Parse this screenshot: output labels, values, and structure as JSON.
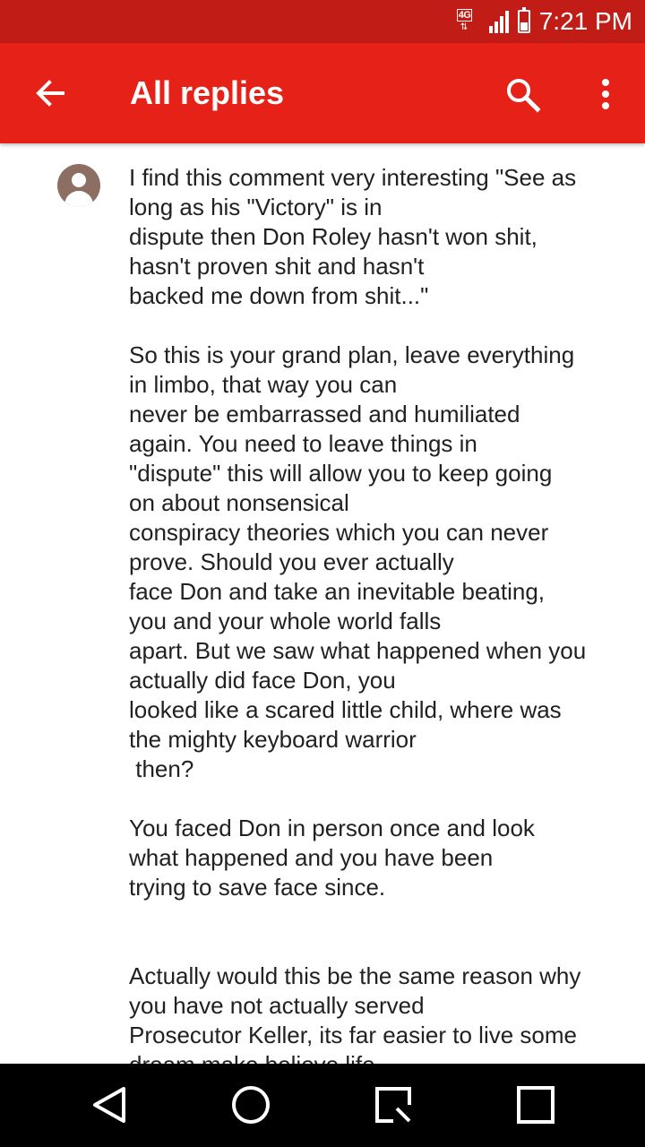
{
  "status_bar": {
    "network_badge": "4G",
    "time": "7:21 PM",
    "battery_level": 0.4,
    "signal_bars": 4
  },
  "app_bar": {
    "title": "All replies",
    "icons": {
      "back": "arrow-back-icon",
      "search": "search-icon",
      "more": "more-vert-icon"
    }
  },
  "comment": {
    "avatar": "default-avatar-icon",
    "text": "I find this comment very interesting \"See as\nlong as his \"Victory\" is in\ndispute then Don Roley hasn't won shit,\nhasn't proven shit and hasn't\nbacked me down from shit...\"\n\nSo this is your grand plan, leave everything\nin limbo, that way you can\nnever be embarrassed and humiliated\nagain. You need to leave things in\n\"dispute\" this will allow you to keep going\non about nonsensical\nconspiracy theories which you can never\nprove. Should you ever actually\nface Don and take an inevitable beating,\nyou and your whole world falls\napart. But we saw what happened when you\nactually did face Don, you\nlooked like a scared little child, where was\nthe mighty keyboard warrior\n then?\n\nYou faced Don in person once and look\nwhat happened and you have been\ntrying to save face since.\n\n\nActually would this be the same reason why\nyou have not actually served\nProsecutor Keller, its far easier to live some\ndream make believe life"
  },
  "nav_bar": {
    "back": "nav-back-icon",
    "home": "nav-home-icon",
    "recents": "nav-recents-icon",
    "multiwindow": "nav-multiwindow-icon"
  },
  "colors": {
    "status_bar": "#c21c17",
    "app_bar": "#e62117",
    "text": "#212121",
    "avatar": "#8d6e63"
  }
}
